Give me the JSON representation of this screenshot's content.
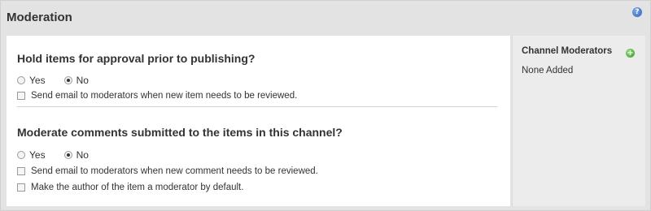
{
  "panel": {
    "title": "Moderation",
    "help_icon": "help-icon",
    "help_glyph": "?"
  },
  "sections": [
    {
      "heading": "Hold items for approval prior to publishing?",
      "radio_yes": "Yes",
      "radio_no": "No",
      "selected": "No",
      "checkbox_email": "Send email to moderators when new item needs to be reviewed."
    },
    {
      "heading": "Moderate comments submitted to the items in this channel?",
      "radio_yes": "Yes",
      "radio_no": "No",
      "selected": "No",
      "checkbox_email": "Send email to moderators when new comment needs to be reviewed.",
      "checkbox_author": "Make the author of the item a moderator by default."
    }
  ],
  "sidebar": {
    "title": "Channel Moderators",
    "add_icon": "add-icon",
    "add_glyph": "+",
    "empty_text": "None Added"
  },
  "colors": {
    "panel_bg": "#e3e3e3",
    "content_bg": "#ffffff",
    "help_icon": "#2c64b8",
    "add_icon": "#3a9a2a"
  }
}
